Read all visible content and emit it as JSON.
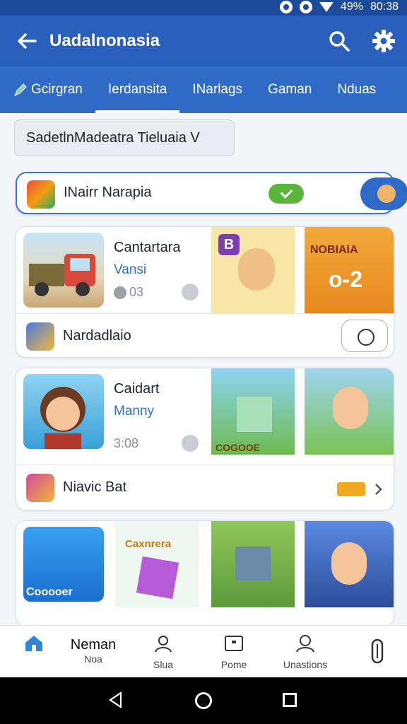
{
  "status_bar": {
    "battery": "49%",
    "time": "80:38"
  },
  "app_bar": {
    "title": "Uadalnonasia"
  },
  "tabs": [
    {
      "label": "Gcirgran",
      "active": false
    },
    {
      "label": "Ierdansita",
      "active": true
    },
    {
      "label": "INarlags",
      "active": false
    },
    {
      "label": "Gaman",
      "active": false
    },
    {
      "label": "Nduas",
      "active": false
    }
  ],
  "filter": {
    "label": "SadetlnMadeatra Tieluaia V"
  },
  "featured": {
    "label": "INairr Narapia"
  },
  "cards": [
    {
      "name": "Cantartara",
      "developer": "Vansi",
      "meta": "03",
      "tile1_badge": "B",
      "tile2_text": "NOBIAIA",
      "tile2_value": "o-2",
      "footer_label": "Nardadlaio"
    },
    {
      "name": "Caidart",
      "developer": "Manny",
      "meta": "3:08",
      "tile1_text": "COGOOE",
      "footer_label": "Niavic Bat"
    },
    {
      "tile0_text": "Cooooer",
      "tile1_text": "Caxnrera"
    }
  ],
  "bottom_nav": [
    {
      "label_top": "Neman",
      "label": "Noa"
    },
    {
      "label": "Slua"
    },
    {
      "label": "Pome"
    },
    {
      "label": "Unastions"
    }
  ],
  "colors": {
    "primary": "#2a5fbd",
    "tab_bar": "#2f6ac6",
    "accent_green": "#5ab53a"
  }
}
